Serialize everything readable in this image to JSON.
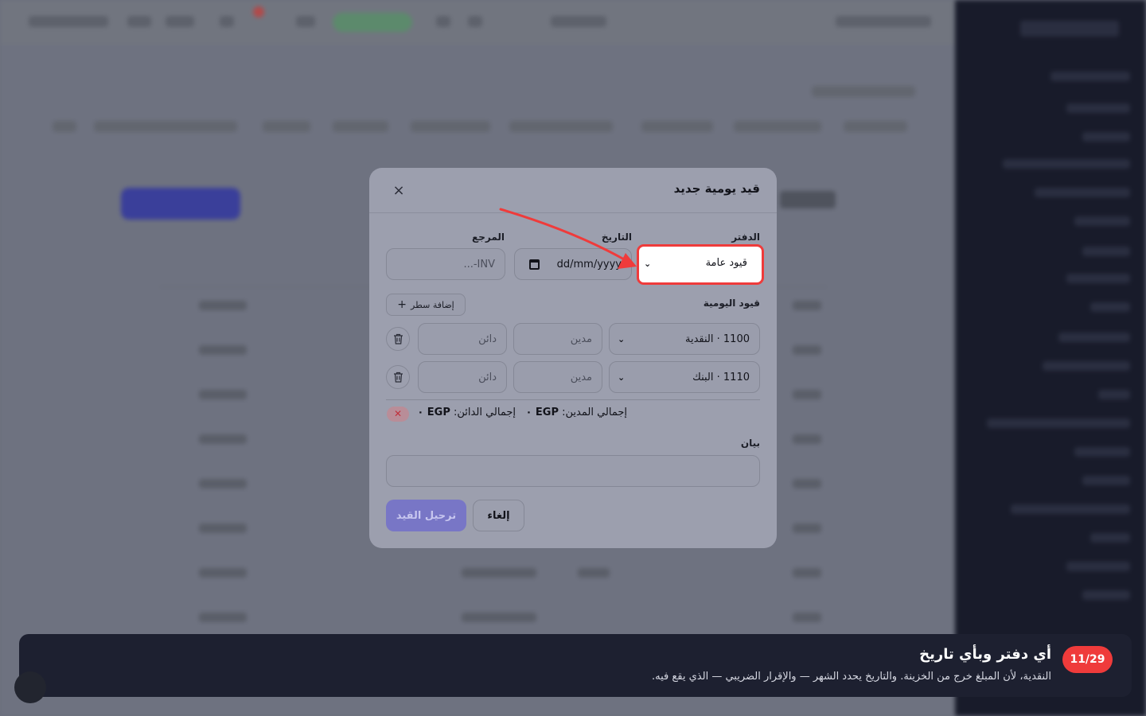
{
  "modal": {
    "title": "قيد يومية جديد",
    "close_glyph": "×",
    "ledger_label": "الدفتر",
    "ledger_value": "قيود عامة",
    "date_label": "التاريخ",
    "date_placeholder": "dd/mm/yyyy",
    "reference_label": "المرجع",
    "reference_placeholder": "INV-...",
    "entries_label": "قيود اليومية",
    "add_line_label": "إضافة سطر",
    "lines": [
      {
        "account": "1100 · النقدية",
        "debit_placeholder": "مدين",
        "credit_placeholder": "دائن"
      },
      {
        "account": "1110 · البنك",
        "debit_placeholder": "مدين",
        "credit_placeholder": "دائن"
      }
    ],
    "total_debit_label": "إجمالي المدين:",
    "total_debit_value": "EGP ٠",
    "total_credit_label": "إجمالي الدائن:",
    "total_credit_value": "EGP ٠",
    "balance_status_glyph": "✕",
    "description_label": "بيان",
    "cancel_label": "إلغاء",
    "post_label": "ترحيل القيد"
  },
  "tour": {
    "step": "11/29",
    "title": "أي دفتر وبأي تاريخ",
    "text": "النقدية، لأن المبلغ خرج من الخزينة. والتاريخ يحدد الشهر — والإقرار الضريبي — الذي يقع فيه."
  },
  "colors": {
    "highlight": "#ef3b3b",
    "primary": "#7876c6",
    "tour_bg": "#1d2030"
  }
}
